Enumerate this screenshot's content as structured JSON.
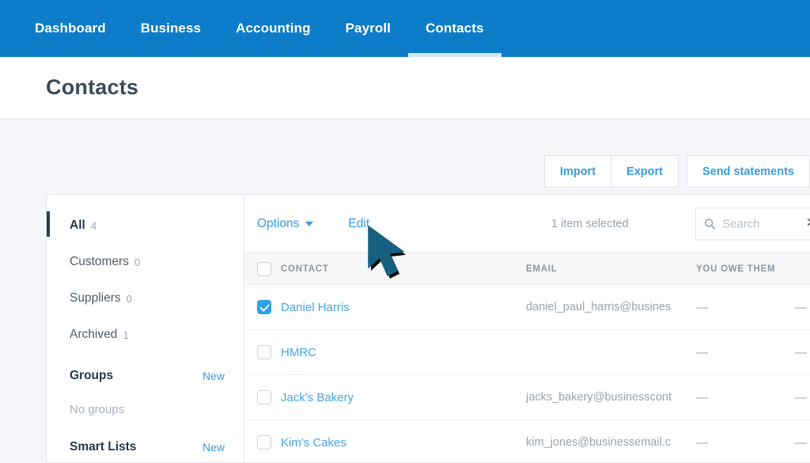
{
  "nav": {
    "items": [
      {
        "label": "Dashboard",
        "active": false
      },
      {
        "label": "Business",
        "active": false
      },
      {
        "label": "Accounting",
        "active": false
      },
      {
        "label": "Payroll",
        "active": false
      },
      {
        "label": "Contacts",
        "active": true
      }
    ]
  },
  "header": {
    "title": "Contacts"
  },
  "actions": {
    "import_label": "Import",
    "export_label": "Export",
    "send_statements_label": "Send statements"
  },
  "sidebar": {
    "filters": [
      {
        "label": "All",
        "count": "4",
        "active": true
      },
      {
        "label": "Customers",
        "count": "0",
        "active": false
      },
      {
        "label": "Suppliers",
        "count": "0",
        "active": false
      },
      {
        "label": "Archived",
        "count": "1",
        "active": false
      }
    ],
    "groups": {
      "title": "Groups",
      "action": "New",
      "empty": "No groups"
    },
    "smart_lists": {
      "title": "Smart Lists",
      "action": "New"
    }
  },
  "toolbar": {
    "options_label": "Options",
    "edit_label": "Edit",
    "selection_status": "1 item selected",
    "search_placeholder": "Search",
    "search_value": "",
    "clear_icon": "✕"
  },
  "table": {
    "columns": [
      "CONTACT",
      "EMAIL",
      "YOU OWE THEM"
    ],
    "rows": [
      {
        "name": "Daniel Harris",
        "email": "daniel_paul_harris@busines",
        "you_owe_them": "—",
        "they_owe_you": "—",
        "selected": true
      },
      {
        "name": "HMRC",
        "email": "",
        "you_owe_them": "—",
        "they_owe_you": "—",
        "selected": false
      },
      {
        "name": "Jack's Bakery",
        "email": "jacks_bakery@businesscont",
        "you_owe_them": "—",
        "they_owe_you": "—",
        "selected": false
      },
      {
        "name": "Kim's Cakes",
        "email": "kim_jones@businessemail.c",
        "you_owe_them": "—",
        "they_owe_you": "—",
        "selected": false
      }
    ]
  },
  "colors": {
    "nav_blue": "#0d7dc9",
    "link_blue": "#3b9ee0",
    "checkbox_blue": "#2ea2e8",
    "cursor_teal": "#17607f",
    "page_bg": "#f4f6f9"
  }
}
